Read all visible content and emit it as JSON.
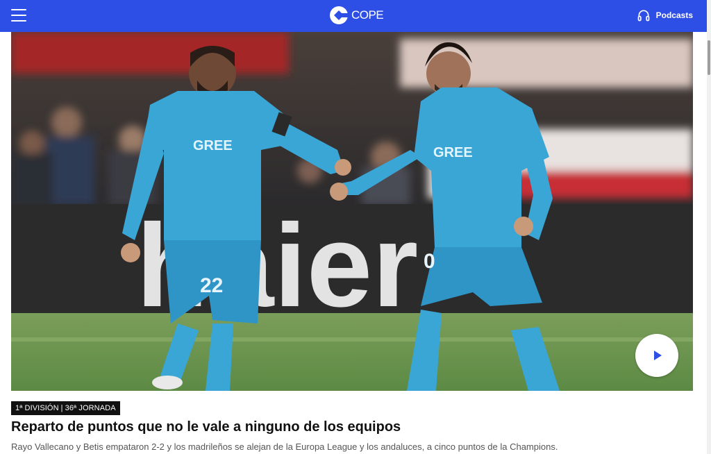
{
  "header": {
    "logo_text": "COPE",
    "podcasts_label": "Podcasts"
  },
  "hero": {
    "jersey_number_left": "22",
    "jersey_number_right": "0",
    "sponsor_text": "GREE",
    "background_text": "haier"
  },
  "article": {
    "tag_division": "1ª DIVISIÓN",
    "tag_round": "36ª JORNADA",
    "headline": "Reparto de puntos que no le vale a ninguno de los equipos",
    "summary": "Rayo Vallecano y Betis empataron 2-2 y los madrileños se alejan de la Europa League y los andaluces, a cinco puntos de la Champions."
  },
  "colors": {
    "brand_blue": "#2e4fe6",
    "kit_blue": "#3aa6d6"
  },
  "icons": [
    "menu-icon",
    "cope-logo-icon",
    "headphones-icon",
    "play-icon"
  ]
}
